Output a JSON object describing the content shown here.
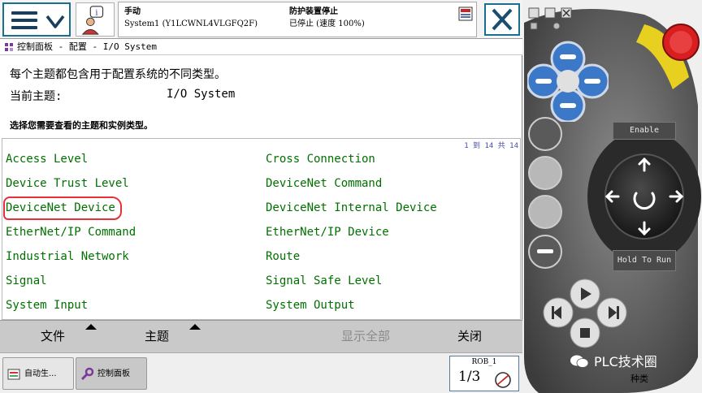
{
  "status_bar": {
    "mode": "手动",
    "system": "System1 (Y1LCWNL4VLGFQ2F)",
    "safety": "防护装置停止",
    "state": "已停止 (速度 100%)"
  },
  "breadcrumb": "控制面板 - 配置 - I/O System",
  "description": {
    "line1": "每个主题都包含用于配置系统的不同类型。",
    "current_topic_label": "当前主题:",
    "current_topic_value": "I/O System",
    "instruction": "选择您需要查看的主题和实例类型。"
  },
  "list": {
    "count_text": "1 到 14 共 14",
    "left": [
      "Access Level",
      "Device Trust Level",
      "DeviceNet Device",
      "EtherNet/IP Command",
      "Industrial Network",
      "Signal",
      "System Input"
    ],
    "right": [
      "Cross Connection",
      "DeviceNet Command",
      "DeviceNet Internal Device",
      "EtherNet/IP Device",
      "Route",
      "Signal Safe Level",
      "System Output"
    ]
  },
  "command_bar": {
    "file": "文件",
    "topic": "主题",
    "show_all": "显示全部",
    "close": "关闭"
  },
  "taskbar": {
    "task1": "自动生...",
    "task2": "控制面板",
    "robot": "ROB_1",
    "fraction": "1/3"
  },
  "pendant": {
    "enable": "Enable",
    "hold_to_run": "Hold To Run",
    "watermark": "PLC技术圈",
    "footer": "种类"
  },
  "colors": {
    "list_text": "#007000",
    "accent": "#1a6e8e",
    "annotation_circle": "#e8303a",
    "emergency_stop": "#d81e1e"
  }
}
